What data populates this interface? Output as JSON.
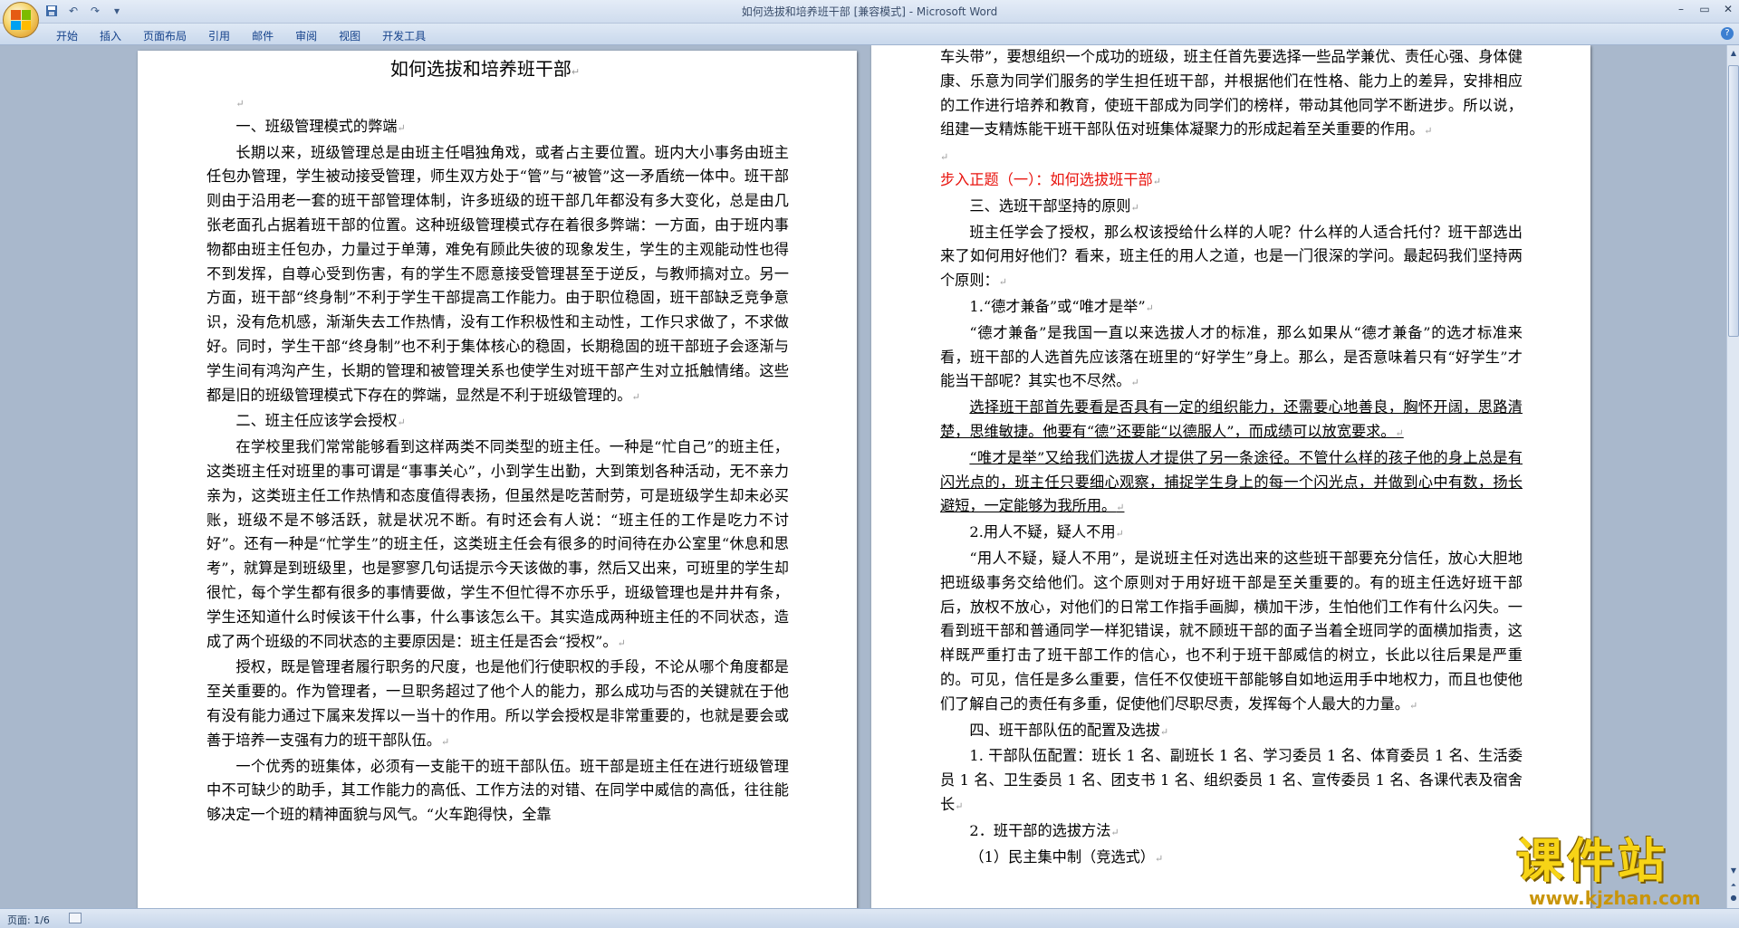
{
  "window": {
    "title": "如何选拔和培养班干部 [兼容模式] - Microsoft Word",
    "minimize": "–",
    "maximize": "▭",
    "close": "✕"
  },
  "ribbon": {
    "tabs": [
      "开始",
      "插入",
      "页面布局",
      "引用",
      "邮件",
      "审阅",
      "视图",
      "开发工具"
    ],
    "help": "?"
  },
  "status": {
    "page": "页面: 1/6"
  },
  "watermark": {
    "text": "课件站",
    "url": "www.kjzhan.com"
  },
  "doc": {
    "title": "如何选拔和培养班干部",
    "left": [
      "",
      "一、班级管理模式的弊端",
      "长期以来，班级管理总是由班主任唱独角戏，或者占主要位置。班内大小事务由班主任包办管理，学生被动接受管理，师生双方处于“管”与“被管”这一矛盾统一体中。班干部则由于沿用老一套的班干部管理体制，许多班级的班干部几年都没有多大变化，总是由几张老面孔占据着班干部的位置。这种班级管理模式存在着很多弊端：一方面，由于班内事物都由班主任包办，力量过于单薄，难免有顾此失彼的现象发生，学生的主观能动性也得不到发挥，自尊心受到伤害，有的学生不愿意接受管理甚至于逆反，与教师搞对立。另一方面，班干部“终身制”不利于学生干部提高工作能力。由于职位稳固，班干部缺乏竞争意识，没有危机感，渐渐失去工作热情，没有工作积极性和主动性，工作只求做了，不求做好。同时，学生干部“终身制”也不利于集体核心的稳固，长期稳固的班干部班子会逐渐与学生间有鸿沟产生，长期的管理和被管理关系也使学生对班干部产生对立抵触情绪。这些都是旧的班级管理模式下存在的弊端，显然是不利于班级管理的。",
      "二、班主任应该学会授权",
      "在学校里我们常常能够看到这样两类不同类型的班主任。一种是“忙自己”的班主任，这类班主任对班里的事可谓是“事事关心”，小到学生出勤，大到策划各种活动，无不亲力亲为，这类班主任工作热情和态度值得表扬，但虽然是吃苦耐劳，可是班级学生却未必买账，班级不是不够活跃，就是状况不断。有时还会有人说：“班主任的工作是吃力不讨好”。还有一种是“忙学生”的班主任，这类班主任会有很多的时间待在办公室里“休息和思考”，就算是到班级里，也是寥寥几句话提示今天该做的事，然后又出来，可班里的学生却很忙，每个学生都有很多的事情要做，学生不但忙得不亦乐乎，班级管理也是井井有条，学生还知道什么时候该干什么事，什么事该怎么干。其实造成两种班主任的不同状态，造成了两个班级的不同状态的主要原因是：班主任是否会“授权”。",
      "授权，既是管理者履行职务的尺度，也是他们行使职权的手段，不论从哪个角度都是至关重要的。作为管理者，一旦职务超过了他个人的能力，那么成功与否的关键就在于他有没有能力通过下属来发挥以一当十的作用。所以学会授权是非常重要的，也就是要会或善于培养一支强有力的班干部队伍。",
      "一个优秀的班集体，必须有一支能干的班干部队伍。班干部是班主任在进行班级管理中不可缺少的助手，其工作能力的高低、工作方法的对错、在同学中威信的高低，往往能够决定一个班的精神面貌与风气。“火车跑得快，全靠"
    ],
    "right": [
      "车头带”，要想组织一个成功的班级，班主任首先要选择一些品学兼优、责任心强、身体健康、乐意为同学们服务的学生担任班干部，并根据他们在性格、能力上的差异，安排相应的工作进行培养和教育，使班干部成为同学们的榜样，带动其他同学不断进步。所以说，组建一支精炼能干班干部队伍对班集体凝聚力的形成起着至关重要的作用。",
      "",
      "步入正题（一）：如何选拔班干部",
      "三、选班干部坚持的原则",
      "班主任学会了授权，那么权该授给什么样的人呢？什么样的人适合托付？班干部选出来了如何用好他们？看来，班主任的用人之道，也是一门很深的学问。最起码我们坚持两个原则：",
      "1.“德才兼备”或“唯才是举”",
      "“德才兼备”是我国一直以来选拔人才的标准，那么如果从“德才兼备”的选才标准来看，班干部的人选首先应该落在班里的“好学生”身上。那么，是否意味着只有“好学生”才能当干部呢？其实也不尽然。",
      "选择班干部首先要看是否具有一定的组织能力，还需要心地善良，胸怀开阔，思路清楚，思维敏捷。他要有“德”还要能“以德服人”，而成绩可以放宽要求。",
      "“唯才是举”又给我们选拔人才提供了另一条途径。不管什么样的孩子他的身上总是有闪光点的，班主任只要细心观察，捕捉学生身上的每一个闪光点，并做到心中有数，扬长避短，一定能够为我所用。",
      "2.用人不疑，疑人不用",
      "“用人不疑，疑人不用”，是说班主任对选出来的这些班干部要充分信任，放心大胆地把班级事务交给他们。这个原则对于用好班干部是至关重要的。有的班主任选好班干部后，放权不放心，对他们的日常工作指手画脚，横加干涉，生怕他们工作有什么闪失。一看到班干部和普通同学一样犯错误，就不顾班干部的面子当着全班同学的面横加指责，这样既严重打击了班干部工作的信心，也不利于班干部威信的树立，长此以往后果是严重的。可见，信任是多么重要，信任不仅使班干部能够自如地运用手中地权力，而且也使他们了解自己的责任有多重，促使他们尽职尽责，发挥每个人最大的力量。",
      "四、班干部队伍的配置及选拔",
      "1. 干部队伍配置：班长 1 名、副班长 1 名、学习委员 1 名、体育委员 1 名、生活委员 1 名、卫生委员 1 名、团支书 1 名、组织委员 1 名、宣传委员 1 名、各课代表及宿舍长",
      "2．班干部的选拔方法",
      "（1）民主集中制（竞选式）"
    ]
  }
}
